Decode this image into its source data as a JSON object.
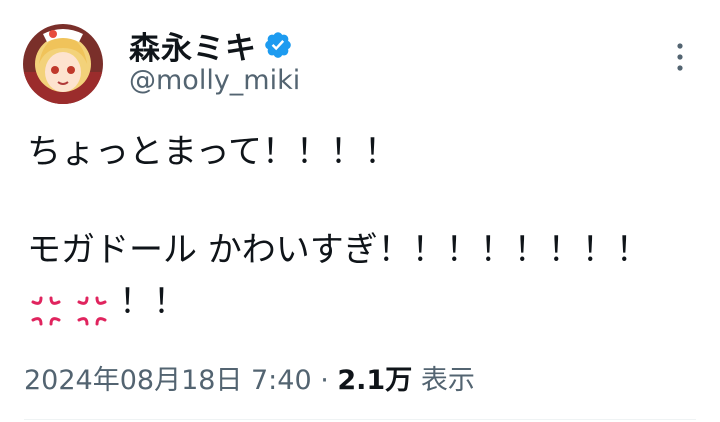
{
  "author": {
    "display_name": "森永ミキ",
    "handle": "@molly_miki",
    "verified": true
  },
  "tweet": {
    "line1": "ちょっとまって！！！！",
    "line2": "モガドール かわいすぎ！！！！！！！！",
    "line3_suffix": "！！",
    "emoji": [
      "anger-symbol-emoji",
      "anger-symbol-emoji"
    ]
  },
  "meta": {
    "timestamp": "2024年08月18日 7:40",
    "separator": " · ",
    "views_count": "2.1万",
    "views_label": "表示"
  },
  "colors": {
    "text": "#0f1419",
    "secondary": "#536471",
    "verified_blue": "#1d9bf0",
    "anger_red": "#e0245e"
  }
}
